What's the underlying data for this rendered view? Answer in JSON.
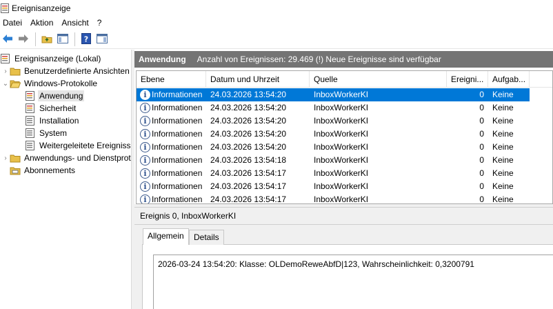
{
  "window": {
    "title": "Ereignisanzeige"
  },
  "menu": [
    "Datei",
    "Aktion",
    "Ansicht",
    "?"
  ],
  "toolbar": {
    "buttons": [
      "back-arrow-icon",
      "forward-arrow-icon",
      "folder-up-icon",
      "console-tree-icon",
      "help-icon",
      "action-pane-icon"
    ]
  },
  "tree": {
    "root": "Ereignisanzeige (Lokal)",
    "custom_views": "Benutzerdefinierte Ansichten",
    "windows_logs": "Windows-Protokolle",
    "children": [
      "Anwendung",
      "Sicherheit",
      "Installation",
      "System",
      "Weitergeleitete Ereignisse"
    ],
    "app_service_logs": "Anwendungs- und Dienstprotokolle",
    "subscriptions": "Abonnements"
  },
  "pane_header": {
    "title": "Anwendung",
    "info": "Anzahl von Ereignissen: 29.469 (!) Neue Ereignisse sind verfügbar"
  },
  "events_table": {
    "columns": [
      "Ebene",
      "Datum und Uhrzeit",
      "Quelle",
      "Ereigni...",
      "Aufgab..."
    ],
    "rows": [
      {
        "level": "Informationen",
        "date": "24.03.2026 13:54:20",
        "source": "InboxWorkerKI",
        "id": "0",
        "task": "Keine"
      },
      {
        "level": "Informationen",
        "date": "24.03.2026 13:54:20",
        "source": "InboxWorkerKI",
        "id": "0",
        "task": "Keine"
      },
      {
        "level": "Informationen",
        "date": "24.03.2026 13:54:20",
        "source": "InboxWorkerKI",
        "id": "0",
        "task": "Keine"
      },
      {
        "level": "Informationen",
        "date": "24.03.2026 13:54:20",
        "source": "InboxWorkerKI",
        "id": "0",
        "task": "Keine"
      },
      {
        "level": "Informationen",
        "date": "24.03.2026 13:54:20",
        "source": "InboxWorkerKI",
        "id": "0",
        "task": "Keine"
      },
      {
        "level": "Informationen",
        "date": "24.03.2026 13:54:18",
        "source": "InboxWorkerKI",
        "id": "0",
        "task": "Keine"
      },
      {
        "level": "Informationen",
        "date": "24.03.2026 13:54:17",
        "source": "InboxWorkerKI",
        "id": "0",
        "task": "Keine"
      },
      {
        "level": "Informationen",
        "date": "24.03.2026 13:54:17",
        "source": "InboxWorkerKI",
        "id": "0",
        "task": "Keine"
      },
      {
        "level": "Informationen",
        "date": "24.03.2026 13:54:17",
        "source": "InboxWorkerKI",
        "id": "0",
        "task": "Keine"
      }
    ]
  },
  "detail": {
    "title": "Ereignis 0, InboxWorkerKI",
    "tabs": [
      "Allgemein",
      "Details"
    ],
    "message": "2026-03-24 13:54:20: Klasse: OLDemoReweAbfD|123, Wahrscheinlichkeit: 0,3200791"
  },
  "colors": {
    "selection": "#0078d7",
    "header_bg": "#747474"
  }
}
